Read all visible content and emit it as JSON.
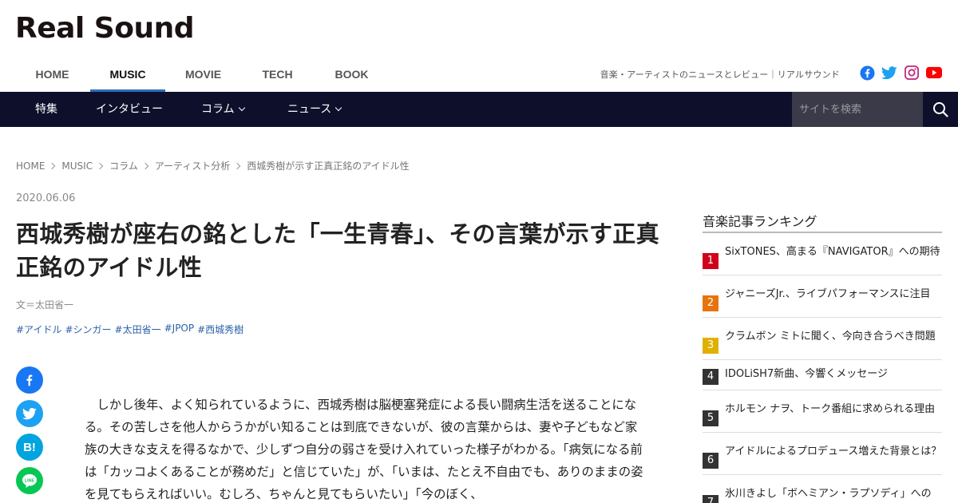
{
  "site": {
    "logo": "Real Sound",
    "tagline": "音楽・アーティストのニュースとレビュー｜リアルサウンド"
  },
  "top_nav": [
    "HOME",
    "MUSIC",
    "MOVIE",
    "TECH",
    "BOOK"
  ],
  "top_nav_active": "MUSIC",
  "social_icons": [
    "facebook-icon",
    "twitter-icon",
    "instagram-icon",
    "youtube-icon"
  ],
  "sub_nav": {
    "items": [
      {
        "label": "特集",
        "has_dropdown": false
      },
      {
        "label": "インタビュー",
        "has_dropdown": false
      },
      {
        "label": "コラム",
        "has_dropdown": true
      },
      {
        "label": "ニュース",
        "has_dropdown": true
      }
    ],
    "search_placeholder": "サイトを検索"
  },
  "breadcrumb": [
    "HOME",
    "MUSIC",
    "コラム",
    "アーティスト分析",
    "西城秀樹が示す正真正銘のアイドル性"
  ],
  "article": {
    "date": "2020.06.06",
    "title": "西城秀樹が座右の銘とした「一生青春」、その言葉が示す正真正銘のアイドル性",
    "author": "文＝太田省一",
    "tags": [
      "#アイドル",
      "#シンガー",
      "#太田省一",
      "#JPOP",
      "#西城秀樹"
    ],
    "body": "しかし後年、よく知られているように、西城秀樹は脳梗塞発症による長い闘病生活を送ることになる。その苦しさを他人からうかがい知ることは到底できないが、彼の言葉からは、妻や子どもなど家族の大きな支えを得るなかで、少しずつ自分の弱さを受け入れていった様子がわかる。「病気になる前は「カッコよくあることが務めだ」と信じていた」が、「いまは、たとえ不自由でも、ありのままの姿を見てもらえればいい。むしろ、ちゃんと見てもらいたい」「今のぼく、"
  },
  "share_buttons": [
    {
      "name": "facebook",
      "glyph": "f",
      "color": "#1877f2"
    },
    {
      "name": "twitter",
      "glyph": "t",
      "color": "#1da1f2"
    },
    {
      "name": "hatena",
      "glyph": "B!",
      "color": "#00a4de"
    },
    {
      "name": "line",
      "glyph": "LINE",
      "color": "#06c755"
    }
  ],
  "ranking": {
    "title": "音楽記事ランキング",
    "items": [
      {
        "rank": "1",
        "text": "SixTONES、高まる『NAVIGATOR』への期待",
        "color": "#d0021b"
      },
      {
        "rank": "2",
        "text": "ジャニーズJr.、ライブパフォーマンスに注目",
        "color": "#e8730c"
      },
      {
        "rank": "3",
        "text": "クラムボン ミトに聞く、今向き合うべき問題",
        "color": "#e0b000"
      },
      {
        "rank": "4",
        "text": "IDOLiSH7新曲、今響くメッセージ",
        "color": "#333333"
      },
      {
        "rank": "5",
        "text": "ホルモン ナヲ、トーク番組に求められる理由",
        "color": "#333333"
      },
      {
        "rank": "6",
        "text": "アイドルによるプロデュース増えた背景とは？",
        "color": "#333333"
      },
      {
        "rank": "7",
        "text": "氷川きよし「ボヘミアン・ラプソディ」への",
        "color": "#333333"
      }
    ]
  }
}
